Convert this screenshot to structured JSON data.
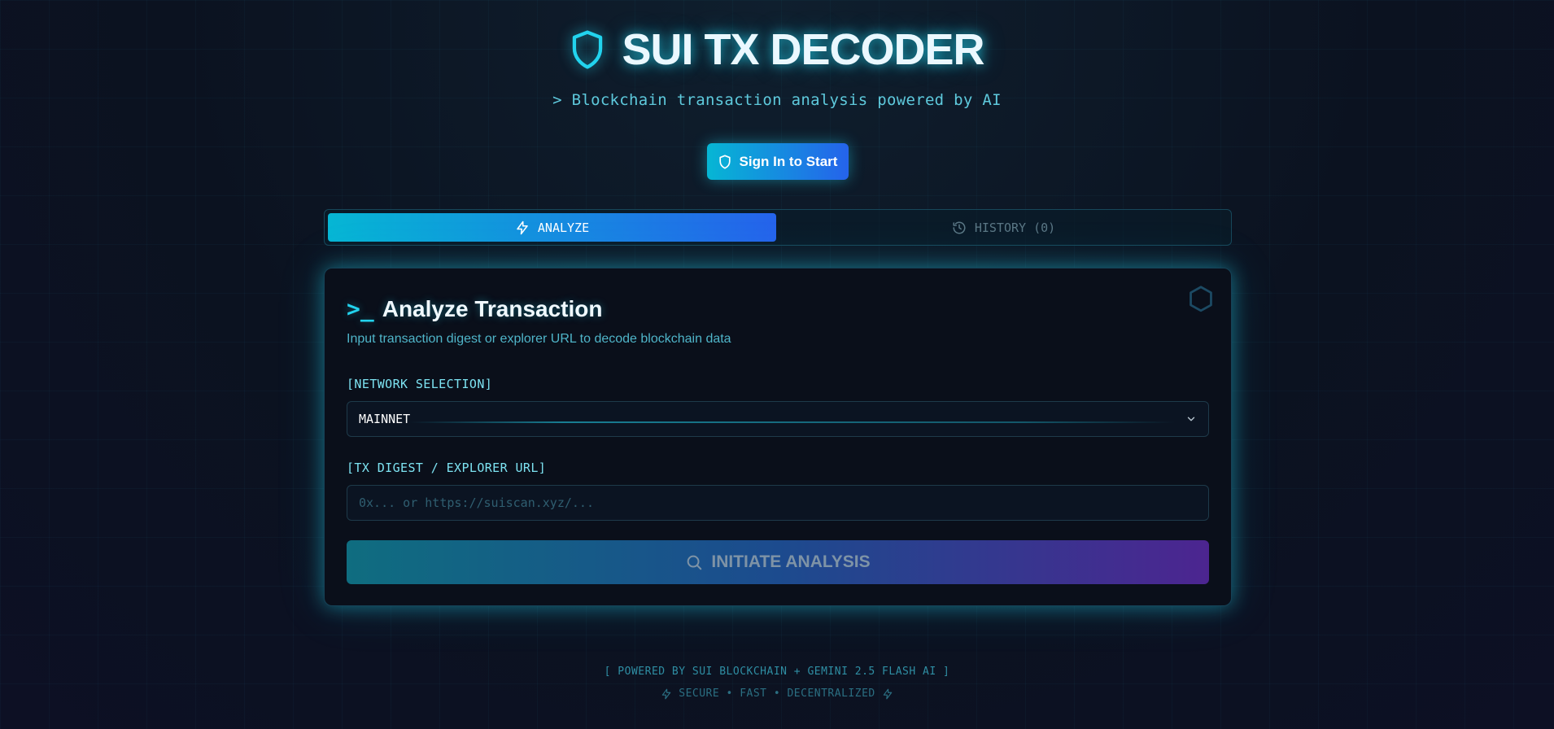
{
  "header": {
    "title": "SUI TX DECODER",
    "subtitle": "> Blockchain transaction analysis powered by AI",
    "icon": "shield-icon"
  },
  "auth": {
    "sign_in_label": "Sign In to Start"
  },
  "tabs": [
    {
      "label": "ANALYZE",
      "icon": "lightning-icon",
      "active": true
    },
    {
      "label": "HISTORY (0)",
      "icon": "history-icon",
      "active": false
    }
  ],
  "card": {
    "prompt": ">_",
    "title": "Analyze Transaction",
    "description": "Input transaction digest or explorer URL to decode blockchain data",
    "network_label": "[NETWORK SELECTION]",
    "network_value": "MAINNET",
    "tx_label": "[TX DIGEST / EXPLORER URL]",
    "tx_placeholder": "0x... or https://suiscan.xyz/...",
    "tx_value": "",
    "analyze_label": "INITIATE ANALYSIS"
  },
  "footer": {
    "line1": "[ POWERED BY SUI BLOCKCHAIN + GEMINI 2.5 FLASH AI ]",
    "line2": "SECURE • FAST • DECENTRALIZED"
  },
  "colors": {
    "accent": "#22d3ee",
    "gradient_start": "#06b6d4",
    "gradient_end": "#2563eb",
    "analyze_end": "#4c2590",
    "background": "#0b1220"
  }
}
